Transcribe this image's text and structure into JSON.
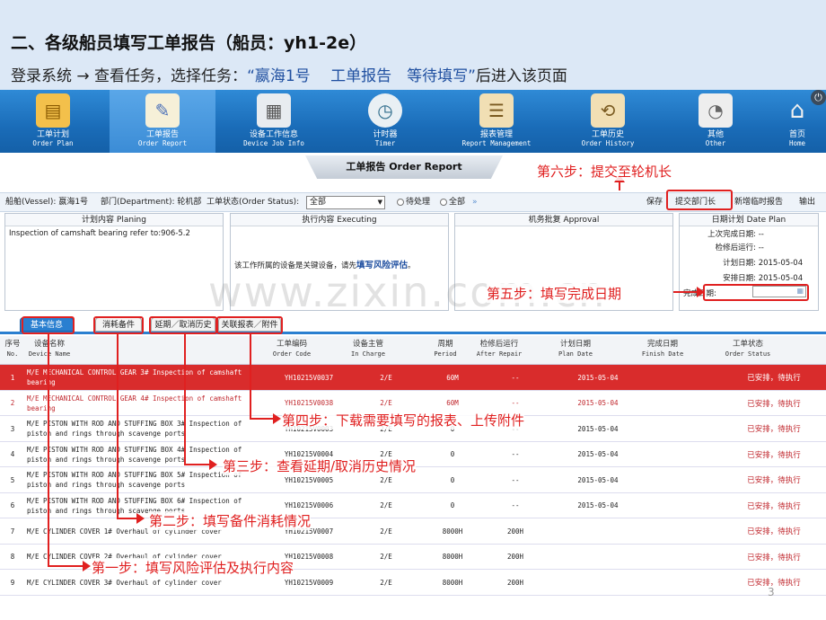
{
  "slide": {
    "title": "二、各级船员填写工单报告（船员：yh1-2e）",
    "subtitle_prefix": "登录系统 → 查看任务，选择任务：",
    "subtitle_highlight": "“嬴海1号　 工单报告　等待填写”",
    "subtitle_suffix": "后进入该页面",
    "page_number": "3",
    "watermark": "www.zixin.com.cn"
  },
  "toolbar": {
    "items": [
      {
        "zh": "工单计划",
        "en": "Order Plan",
        "icon": "folder-icon"
      },
      {
        "zh": "工单报告",
        "en": "Order Report",
        "icon": "report-pencil-icon"
      },
      {
        "zh": "设备工作信息",
        "en": "Device Job Info",
        "icon": "device-doc-icon"
      },
      {
        "zh": "计时器",
        "en": "Timer",
        "icon": "clock-icon"
      },
      {
        "zh": "报表管理",
        "en": "Report Management",
        "icon": "report-sheet-icon"
      },
      {
        "zh": "工单历史",
        "en": "Order History",
        "icon": "history-icon"
      },
      {
        "zh": "其他",
        "en": "Other",
        "icon": "pie-chart-icon"
      },
      {
        "zh": "首页",
        "en": "Home",
        "icon": "home-icon"
      }
    ]
  },
  "subtab": {
    "label": "工单报告 Order Report"
  },
  "filter": {
    "vessel_label": "船舶(Vessel): 嬴海1号",
    "dept_label": "部门(Department): 轮机部",
    "status_label": "工单状态(Order Status):",
    "status_value": "全部",
    "radio_pending": "待处理",
    "radio_all": "全部",
    "save": "保存",
    "submit": "提交部门长",
    "add_temp": "新增临时报告",
    "export": "输出"
  },
  "panels": {
    "plan_title": "计划内容 Planing",
    "plan_text": "Inspection of camshaft bearing refer to:906-5.2",
    "exec_title": "执行内容 Executing",
    "exec_text_prefix": "该工作所属的设备是关键设备，请先",
    "exec_text_link": "填写风险评估",
    "exec_text_suffix": "。",
    "approval_title": "机务批复 Approval",
    "dates_title": "日期计划 Date Plan",
    "last_done_label": "上次完成日期:",
    "last_done_value": "--",
    "after_repair_label": "检修后运行:",
    "after_repair_value": "--",
    "plan_date_label": "计划日期:",
    "plan_date_value": "2015-05-04",
    "arrange_date_label": "安排日期:",
    "arrange_date_value": "2015-05-04",
    "finish_date_label": "完成日期:"
  },
  "inner_tabs": [
    "基本信息",
    "消耗备件",
    "延期／取消历史",
    "关联报表／附件"
  ],
  "table": {
    "headers": [
      {
        "zh": "序号",
        "en": "No."
      },
      {
        "zh": "设备名称",
        "en": "Device Name"
      },
      {
        "zh": "工单编码",
        "en": "Order Code"
      },
      {
        "zh": "设备主管",
        "en": "In Charge"
      },
      {
        "zh": "周期",
        "en": "Period"
      },
      {
        "zh": "检修后运行",
        "en": "After Repair"
      },
      {
        "zh": "计划日期",
        "en": "Plan Date"
      },
      {
        "zh": "完成日期",
        "en": "Finish Date"
      },
      {
        "zh": "工单状态",
        "en": "Order Status"
      }
    ],
    "rows": [
      {
        "no": "1",
        "name": "M/E MECHANICAL CONTROL GEAR 3# Inspection of camshaft bearing",
        "code": "YH10215V0037",
        "charge": "2/E",
        "period": "60M",
        "after": "--",
        "plan": "2015-05-04",
        "finish": "",
        "status": "已安排，待执行"
      },
      {
        "no": "2",
        "name": "M/E MECHANICAL CONTROL GEAR 4# Inspection of camshaft bearing",
        "code": "YH10215V0038",
        "charge": "2/E",
        "period": "60M",
        "after": "--",
        "plan": "2015-05-04",
        "finish": "",
        "status": "已安排，待执行"
      },
      {
        "no": "3",
        "name": "M/E PISTON WITH ROD AND STUFFING BOX 3# Inspection of piston and rings through scavenge ports",
        "code": "YH10215V0003",
        "charge": "2/E",
        "period": "0",
        "after": "--",
        "plan": "2015-05-04",
        "finish": "",
        "status": "已安排，待执行"
      },
      {
        "no": "4",
        "name": "M/E PISTON WITH ROD AND STUFFING BOX 4# Inspection of piston and rings through scavenge ports",
        "code": "YH10215V0004",
        "charge": "2/E",
        "period": "0",
        "after": "--",
        "plan": "2015-05-04",
        "finish": "",
        "status": "已安排，待执行"
      },
      {
        "no": "5",
        "name": "M/E PISTON WITH ROD AND STUFFING BOX 5# Inspection of piston and rings through scavenge ports",
        "code": "YH10215V0005",
        "charge": "2/E",
        "period": "0",
        "after": "--",
        "plan": "2015-05-04",
        "finish": "",
        "status": "已安排，待执行"
      },
      {
        "no": "6",
        "name": "M/E PISTON WITH ROD AND STUFFING BOX 6# Inspection of piston and rings through scavenge ports",
        "code": "YH10215V0006",
        "charge": "2/E",
        "period": "0",
        "after": "--",
        "plan": "2015-05-04",
        "finish": "",
        "status": "已安排，待执行"
      },
      {
        "no": "7",
        "name": "M/E CYLINDER COVER 1# Overhaul of cylinder cover",
        "code": "YH10215V0007",
        "charge": "2/E",
        "period": "8000H",
        "after": "200H",
        "plan": "",
        "finish": "",
        "status": "已安排，待执行"
      },
      {
        "no": "8",
        "name": "M/E CYLINDER COVER 2# Overhaul of cylinder cover",
        "code": "YH10215V0008",
        "charge": "2/E",
        "period": "8000H",
        "after": "200H",
        "plan": "",
        "finish": "",
        "status": "已安排，待执行"
      },
      {
        "no": "9",
        "name": "M/E CYLINDER COVER 3# Overhaul of cylinder cover",
        "code": "YH10215V0009",
        "charge": "2/E",
        "period": "8000H",
        "after": "200H",
        "plan": "",
        "finish": "",
        "status": "已安排，待执行"
      }
    ]
  },
  "annotations": {
    "step1": "第一步：填写风险评估及执行内容",
    "step2": "第二步：填写备件消耗情况",
    "step3": "第三步：查看延期/取消历史情况",
    "step4": "第四步：下载需要填写的报表、上传附件",
    "step5": "第五步：填写完成日期",
    "step6": "第六步：提交至轮机长"
  },
  "colors": {
    "accent": "#e02020",
    "toolbar": "#1a6cb8",
    "selected_row": "#d92c2c",
    "header_bg": "#dce8f6"
  }
}
